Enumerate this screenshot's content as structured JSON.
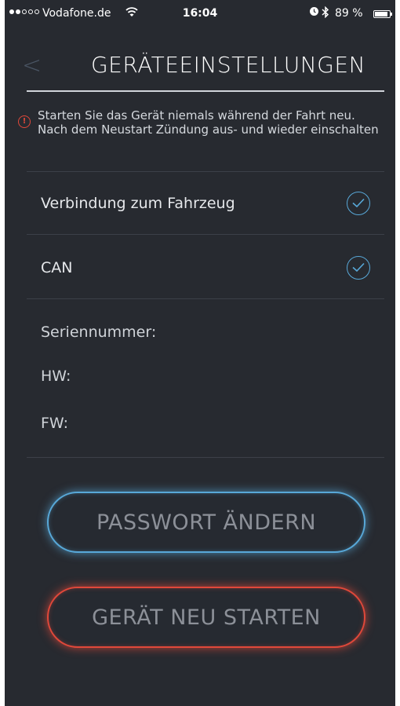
{
  "status_bar": {
    "carrier": "Vodafone.de",
    "time": "16:04",
    "battery": "89 %",
    "battery_level": 0.89,
    "signal_bars": 2,
    "signal_total": 5,
    "icons": [
      "wifi-icon",
      "alarm-icon",
      "bluetooth-icon",
      "battery-icon"
    ]
  },
  "header": {
    "back_glyph": "<",
    "title": "GERÄTEEINSTELLUNGEN"
  },
  "warning": {
    "icon_glyph": "!",
    "text": "Starten Sie das Gerät niemals während der Fahrt neu. Nach dem Neustart Zündung aus- und wieder einschalten"
  },
  "status_rows": [
    {
      "label": "Verbindung zum Fahrzeug",
      "status": "ok"
    },
    {
      "label": "CAN",
      "status": "ok"
    }
  ],
  "device_info": {
    "serial_label": "Seriennummer:",
    "hw_label": "HW:",
    "fw_label": "FW:"
  },
  "buttons": {
    "change_password": "PASSWORT ÄNDERN",
    "restart_device": "GERÄT NEU STARTEN"
  },
  "colors": {
    "background": "#272a30",
    "accent_blue": "#58a8d8",
    "accent_red": "#e0483a"
  }
}
